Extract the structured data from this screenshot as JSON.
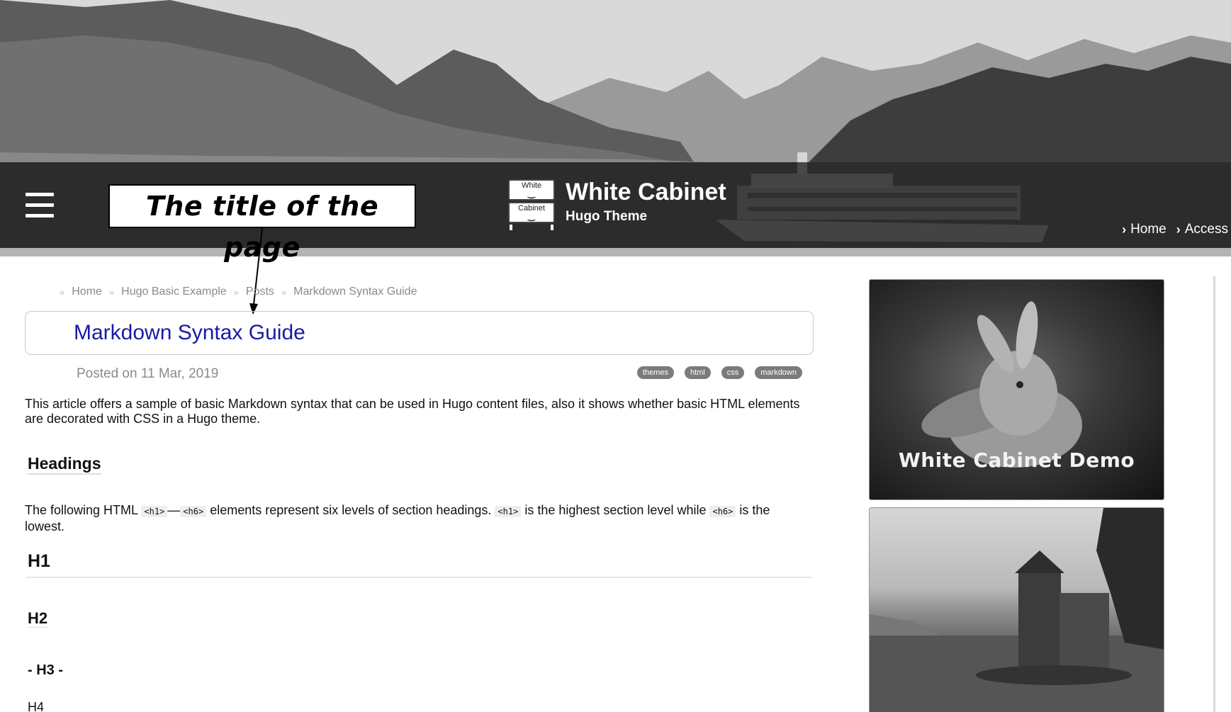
{
  "header": {
    "site_title": "White Cabinet",
    "site_subtitle": "Hugo Theme",
    "logo_top_drawer": "White",
    "logo_bottom_drawer": "Cabinet",
    "nav": [
      {
        "label": "Home"
      },
      {
        "label": "Access"
      }
    ]
  },
  "annotation": {
    "callout": "The title of the page"
  },
  "breadcrumb": [
    "Home",
    "Hugo Basic Example",
    "Posts",
    "Markdown Syntax Guide"
  ],
  "post": {
    "title": "Markdown Syntax Guide",
    "posted": "Posted on 11 Mar, 2019",
    "tags": [
      "themes",
      "html",
      "css",
      "markdown"
    ],
    "intro": "This article offers a sample of basic Markdown syntax that can be used in Hugo content files, also it shows whether basic HTML elements are decorated with CSS in a Hugo theme.",
    "headings_title": "Headings",
    "para2_a": "The following HTML ",
    "code_h1": "<h1>",
    "dash": "—",
    "code_h6": "<h6>",
    "para2_b": " elements represent six levels of section headings. ",
    "para2_c": " is the highest section level while ",
    "para2_d": " is the lowest.",
    "h1": "H1",
    "h2": "H2",
    "h3": "- H3 -",
    "h4": "H4"
  },
  "sidebar": {
    "banner_caption": "White Cabinet Demo"
  }
}
